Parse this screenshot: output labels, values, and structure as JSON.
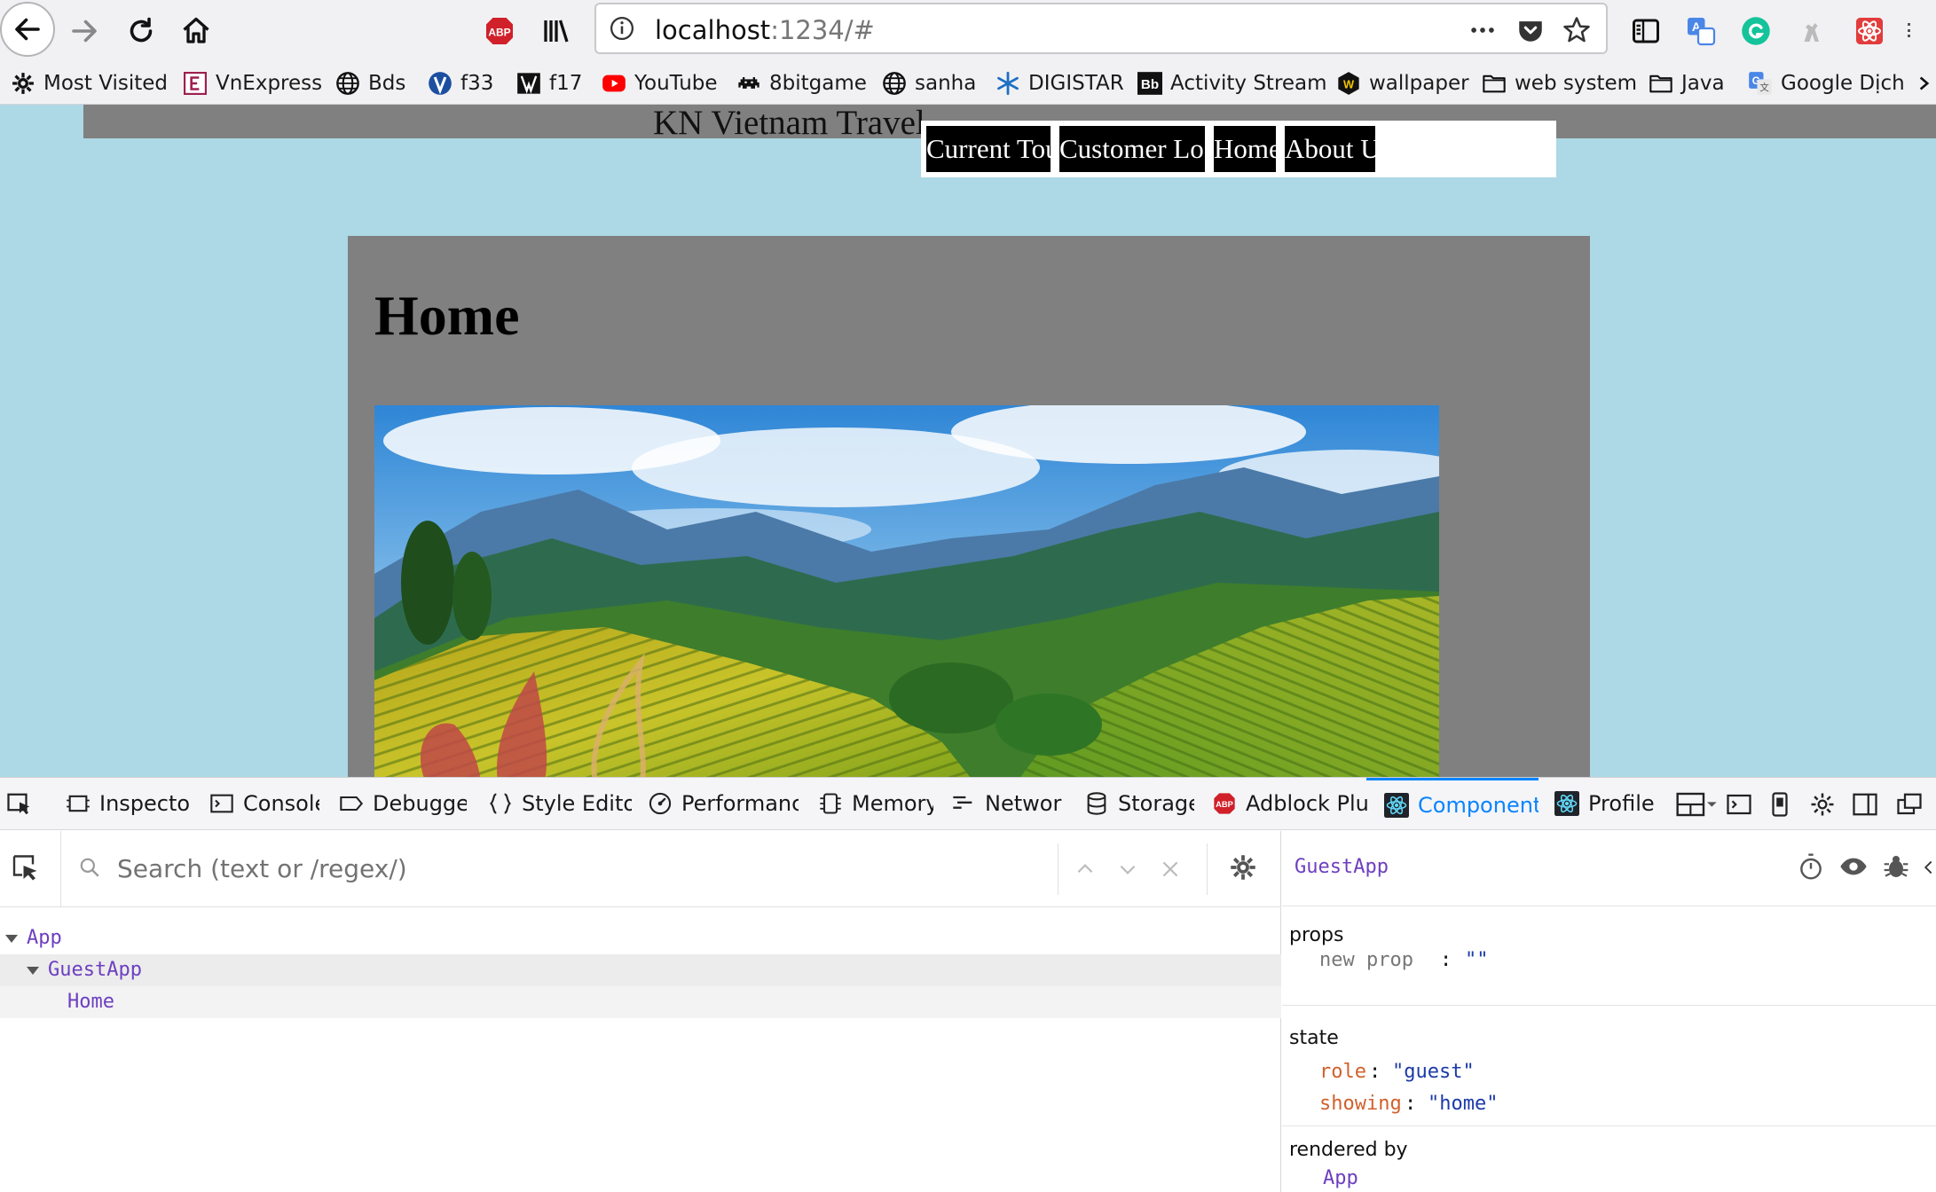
{
  "browser": {
    "url_host": "localhost",
    "url_rest": ":1234/#",
    "toolbar_icons": [
      "back-arrow-icon",
      "forward-arrow-icon",
      "reload-icon",
      "home-icon",
      "adblock-icon",
      "library-icon",
      "page-info-icon",
      "more-dots-icon",
      "pocket-icon",
      "bookmark-star-icon",
      "reader-sidebar-icon",
      "translate-icon",
      "grammarly-icon",
      "extension-icon",
      "react-ext-icon"
    ],
    "adblock_badge": "ABP"
  },
  "bookmarks": [
    {
      "label": "Most Visited",
      "icon": "gear-icon"
    },
    {
      "label": "VnExpress",
      "icon": "vnexpress-icon"
    },
    {
      "label": "Bds",
      "icon": "globe-icon"
    },
    {
      "label": "f33",
      "icon": "f33-icon"
    },
    {
      "label": "f17",
      "icon": "f17-icon"
    },
    {
      "label": "YouTube",
      "icon": "youtube-icon"
    },
    {
      "label": "8bitgame",
      "icon": "invader-icon"
    },
    {
      "label": "sanha",
      "icon": "globe-icon"
    },
    {
      "label": "DIGISTAR",
      "icon": "digistar-icon"
    },
    {
      "label": "Activity Stream",
      "icon": "blackboard-icon"
    },
    {
      "label": "wallpaper",
      "icon": "wallpaper-icon"
    },
    {
      "label": "web system",
      "icon": "folder-icon"
    },
    {
      "label": "Java",
      "icon": "folder-icon"
    },
    {
      "label": "Google Dịch",
      "icon": "google-translate-icon"
    }
  ],
  "bookmark_badges": {
    "activity": "Bb",
    "wallpaper": "W"
  },
  "site": {
    "title": "KN Vietnam Travel",
    "nav": [
      "Current Tours",
      "Customer Login",
      "Home",
      "About Us"
    ],
    "page_heading": "Home",
    "hero_image": "rice-terrace-landscape"
  },
  "devtools": {
    "tabs": [
      "Inspecto",
      "Console",
      "Debugge",
      "Style Edito",
      "Performanc",
      "Memory",
      "Networ",
      "Storage",
      "Adblock Plu",
      "Component",
      "Profile"
    ],
    "active_tab": "Component",
    "search_placeholder": "Search (text or /regex/)",
    "tree": [
      {
        "label": "App",
        "depth": 0,
        "expanded": true
      },
      {
        "label": "GuestApp",
        "depth": 1,
        "expanded": true,
        "selected": true
      },
      {
        "label": "Home",
        "depth": 2
      }
    ],
    "inspector": {
      "component": "GuestApp",
      "props_label": "props",
      "props": [
        {
          "key": "new prop",
          "value": "\"\""
        }
      ],
      "state_label": "state",
      "state": [
        {
          "key": "role",
          "value": "\"guest\""
        },
        {
          "key": "showing",
          "value": "\"home\""
        }
      ],
      "rendered_by_label": "rendered by",
      "rendered_by": "App"
    }
  },
  "colors": {
    "page_bg": "#add8e6",
    "header_gray": "#808080",
    "nav_black": "#000000",
    "devtools_accent": "#0a84ff",
    "component_purple": "#6d3fc0",
    "state_key_orange": "#d2602c",
    "value_blue": "#1b3aa8"
  }
}
